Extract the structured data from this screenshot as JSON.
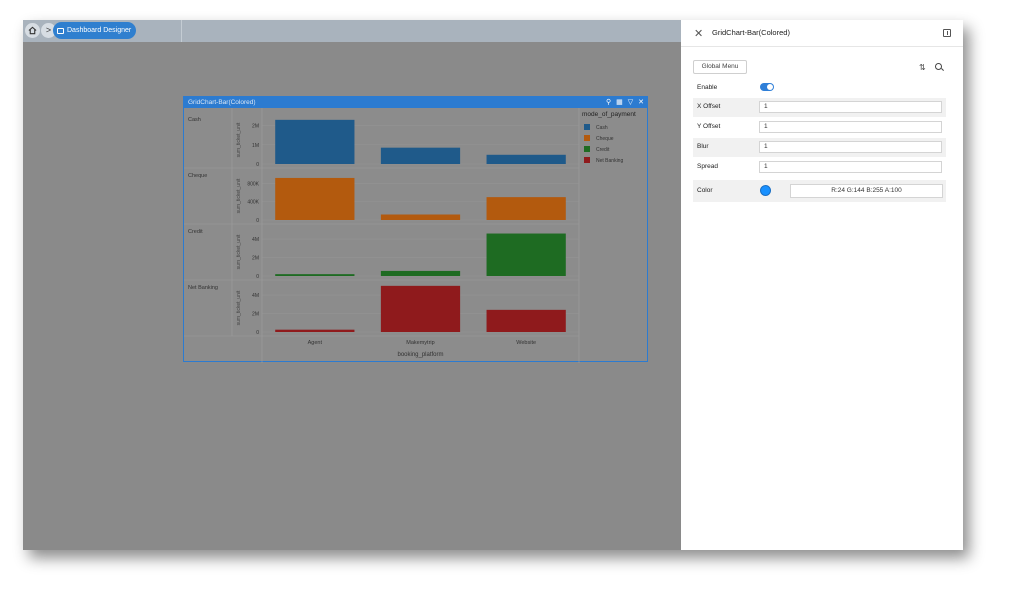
{
  "breadcrumb": {
    "current_label": "Dashboard Designer"
  },
  "widget": {
    "title": "GridChart-Bar(Colored)"
  },
  "chart_data": {
    "type": "bar",
    "xlabel": "booking_platform",
    "categories": [
      "Agent",
      "Makemytrip",
      "Website"
    ],
    "legend_title": "mode_of_payment",
    "legend_position": "right",
    "rows": [
      {
        "name": "Cash",
        "color": "#1f5a8a",
        "ylabel": "sum_ticket_unit",
        "ylim": [
          0,
          2500000
        ],
        "ticks": [
          {
            "v": 0,
            "label": "0"
          },
          {
            "v": 1000000,
            "label": "1M"
          },
          {
            "v": 2000000,
            "label": "2M"
          }
        ],
        "values": [
          2300000,
          850000,
          480000
        ]
      },
      {
        "name": "Cheque",
        "color": "#b35a0e",
        "ylabel": "sum_ticket_unit",
        "ylim": [
          0,
          1050000
        ],
        "ticks": [
          {
            "v": 0,
            "label": "0"
          },
          {
            "v": 400000,
            "label": "400K"
          },
          {
            "v": 800000,
            "label": "800K"
          }
        ],
        "values": [
          920000,
          120000,
          500000
        ]
      },
      {
        "name": "Credit",
        "color": "#1e6b22",
        "ylabel": "sum_ticket_unit",
        "ylim": [
          0,
          5200000
        ],
        "ticks": [
          {
            "v": 0,
            "label": "0"
          },
          {
            "v": 2000000,
            "label": "2M"
          },
          {
            "v": 4000000,
            "label": "4M"
          }
        ],
        "values": [
          200000,
          550000,
          4600000
        ]
      },
      {
        "name": "Net Banking",
        "color": "#8f1a1c",
        "ylabel": "sum_ticket_unit",
        "ylim": [
          0,
          5200000
        ],
        "ticks": [
          {
            "v": 0,
            "label": "0"
          },
          {
            "v": 2000000,
            "label": "2M"
          },
          {
            "v": 4000000,
            "label": "4M"
          }
        ],
        "values": [
          250000,
          5000000,
          2400000
        ]
      }
    ]
  },
  "panel": {
    "title": "GridChart-Bar(Colored)",
    "global_menu_label": "Global Menu",
    "enable_label": "Enable",
    "enable_on": true,
    "x_offset_label": "X Offset",
    "x_offset_value": "1",
    "y_offset_label": "Y Offset",
    "y_offset_value": "1",
    "blur_label": "Blur",
    "blur_value": "1",
    "spread_label": "Spread",
    "spread_value": "1",
    "color_label": "Color",
    "color_value": "R:24 G:144 B:255 A:100",
    "color_swatch": "#1890ff"
  }
}
